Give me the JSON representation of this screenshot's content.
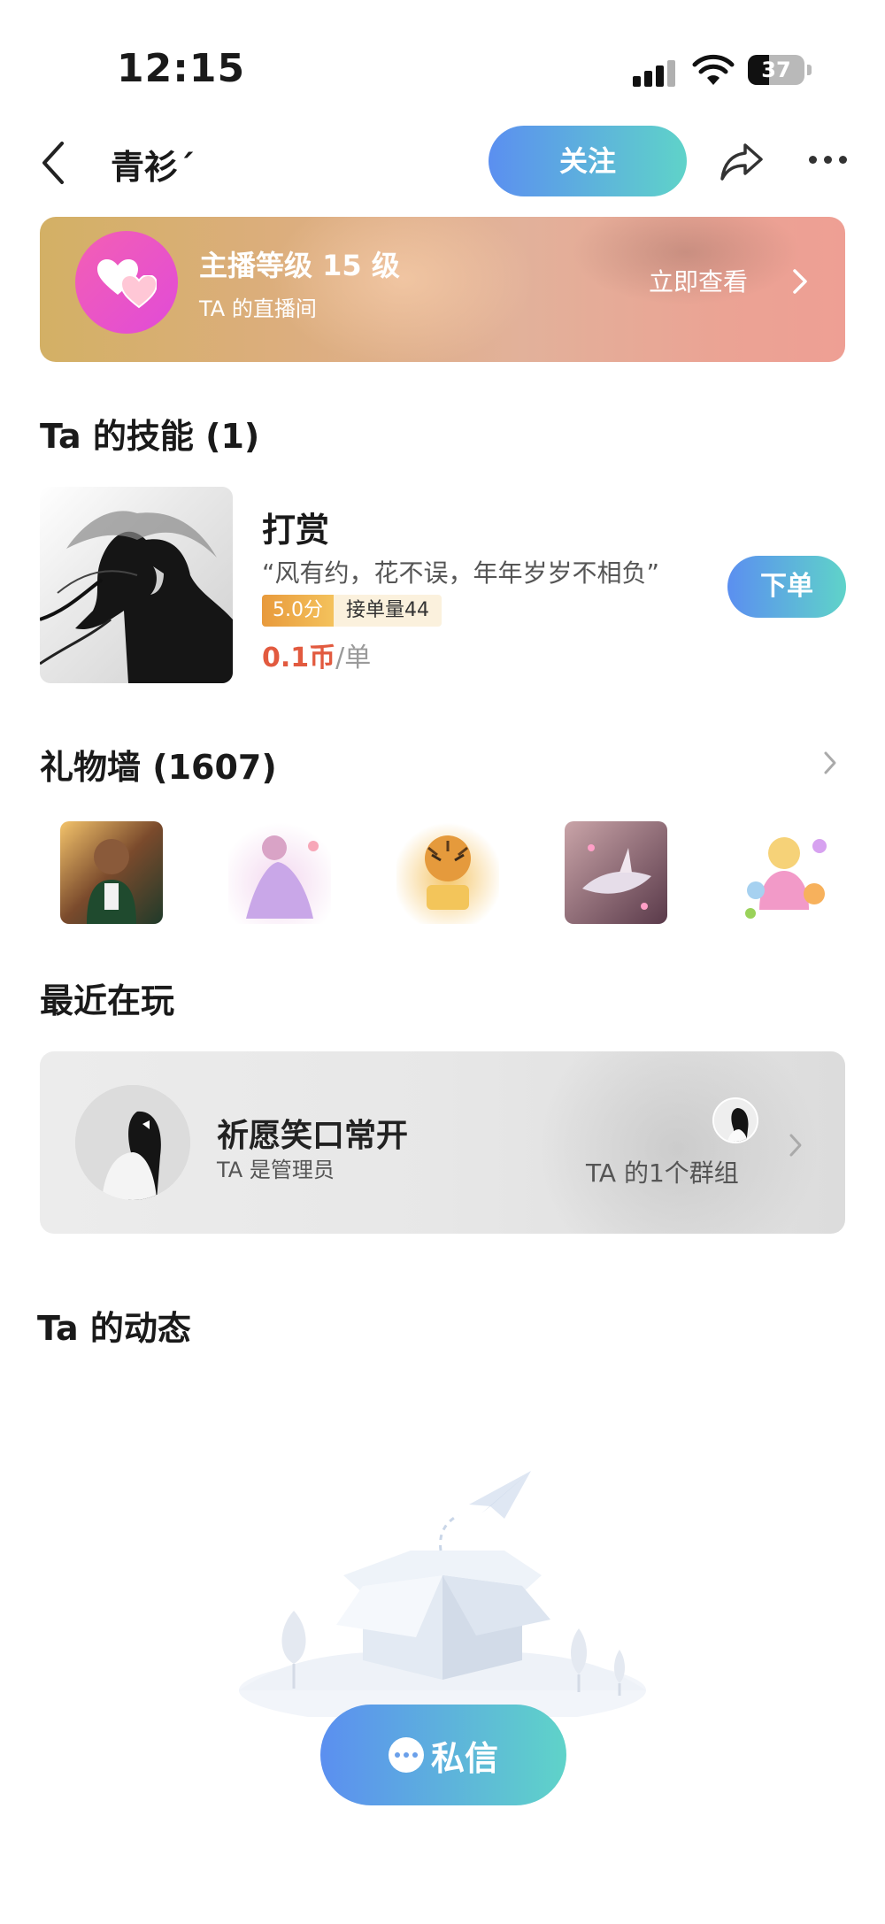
{
  "status_bar": {
    "time": "12:15",
    "battery": "37",
    "battery_level": 0.37
  },
  "nav": {
    "title": "青衫´",
    "follow_label": "关注"
  },
  "live_banner": {
    "title": "主播等级 15 级",
    "subtitle": "TA 的直播间",
    "action": "立即查看"
  },
  "skills": {
    "title": "Ta 的技能 (1)",
    "item": {
      "name": "打赏",
      "quote": "“风有约，花不误，年年岁岁不相负”",
      "score": "5.0分",
      "orders": "接单量44",
      "price": "0.1币",
      "price_unit": "/单",
      "order_label": "下单"
    }
  },
  "gift_wall": {
    "title": "礼物墙 (1607)"
  },
  "recent": {
    "title": "最近在玩",
    "group_name": "祈愿笑口常开",
    "role": "TA 是管理员",
    "groups_count": "TA 的1个群组"
  },
  "feed": {
    "title": "Ta 的动态"
  },
  "message_btn": {
    "label": "私信"
  },
  "colors": {
    "accent_start": "#5b8ff0",
    "accent_end": "#5fd3c9",
    "price": "#e25a3f"
  }
}
